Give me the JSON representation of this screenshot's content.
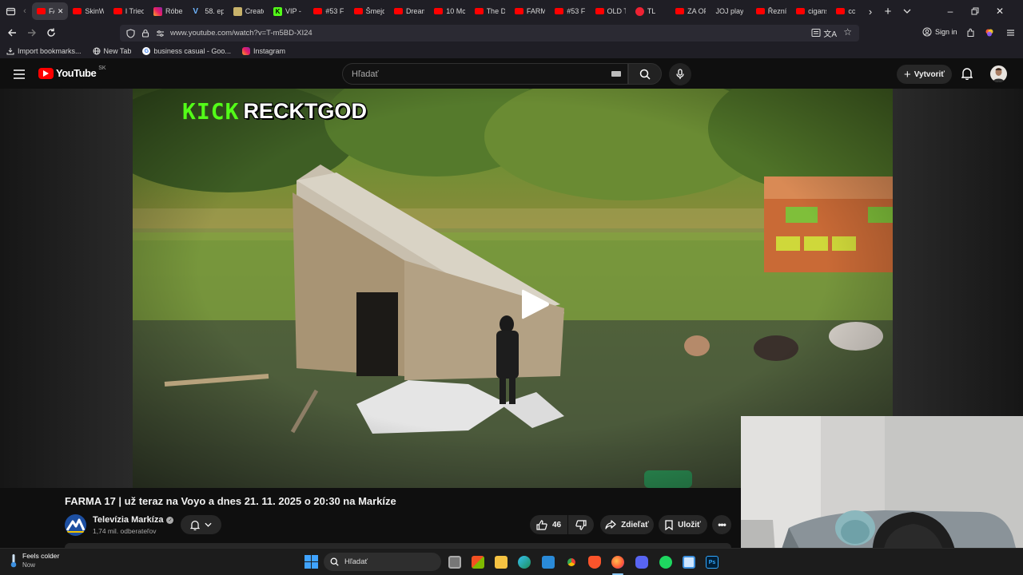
{
  "browser": {
    "tabs": [
      {
        "label": "FAR",
        "icon": "youtube-icon",
        "active": true
      },
      {
        "label": "SkinW",
        "icon": "youtube-icon"
      },
      {
        "label": "I Tried",
        "icon": "youtube-icon"
      },
      {
        "label": "Róber",
        "icon": "instagram-icon"
      },
      {
        "label": "58. ep",
        "icon": "v-icon"
      },
      {
        "label": "Create",
        "icon": "page-icon"
      },
      {
        "label": "VIP - ",
        "icon": "kick-icon"
      },
      {
        "label": "#53 F",
        "icon": "youtube-icon"
      },
      {
        "label": "Šmejd",
        "icon": "youtube-icon"
      },
      {
        "label": "Dream",
        "icon": "youtube-icon"
      },
      {
        "label": "10 Mc",
        "icon": "youtube-icon"
      },
      {
        "label": "The D",
        "icon": "youtube-icon"
      },
      {
        "label": "FARM",
        "icon": "youtube-icon"
      },
      {
        "label": "#53 F",
        "icon": "youtube-icon"
      },
      {
        "label": "OLD T",
        "icon": "youtube-icon"
      },
      {
        "label": "TL",
        "icon": "record-icon"
      },
      {
        "label": "ZA OF",
        "icon": "youtube-icon"
      },
      {
        "label": "JOJ play",
        "icon": "none"
      },
      {
        "label": "Řezník",
        "icon": "youtube-icon"
      },
      {
        "label": "cigans",
        "icon": "youtube-icon"
      },
      {
        "label": "cc",
        "icon": "youtube-icon"
      }
    ],
    "tab_close": "✕",
    "url": "www.youtube.com/watch?v=T-m5BD-XI24",
    "sign_in": "Sign in",
    "bookmarks": [
      {
        "label": "Import bookmarks...",
        "icon": "import-icon"
      },
      {
        "label": "New Tab",
        "icon": "globe-icon"
      },
      {
        "label": "business casual - Goo...",
        "icon": "google-icon"
      },
      {
        "label": "Instagram",
        "icon": "instagram-icon"
      }
    ]
  },
  "youtube": {
    "logo_text": "YouTube",
    "region": "SK",
    "search_placeholder": "Hľadať",
    "create_label": "Vytvoriť"
  },
  "video": {
    "overlay_kick": "KICK",
    "overlay_name": "RECKTGOD",
    "title": "FARMA 17 | už teraz na Voyo a dnes 21. 11. 2025 o 20:30 na Markíze",
    "channel_name": "Televízia Markíza",
    "subscribers": "1,74 mil. odberateľov",
    "likes": "46",
    "share_label": "Zdieľať",
    "save_label": "Uložiť"
  },
  "taskbar": {
    "weather_title": "Feels colder",
    "weather_sub": "Now",
    "search_label": "Hľadať"
  },
  "colors": {
    "accent": "#ff0000",
    "kick": "#53fc18"
  }
}
